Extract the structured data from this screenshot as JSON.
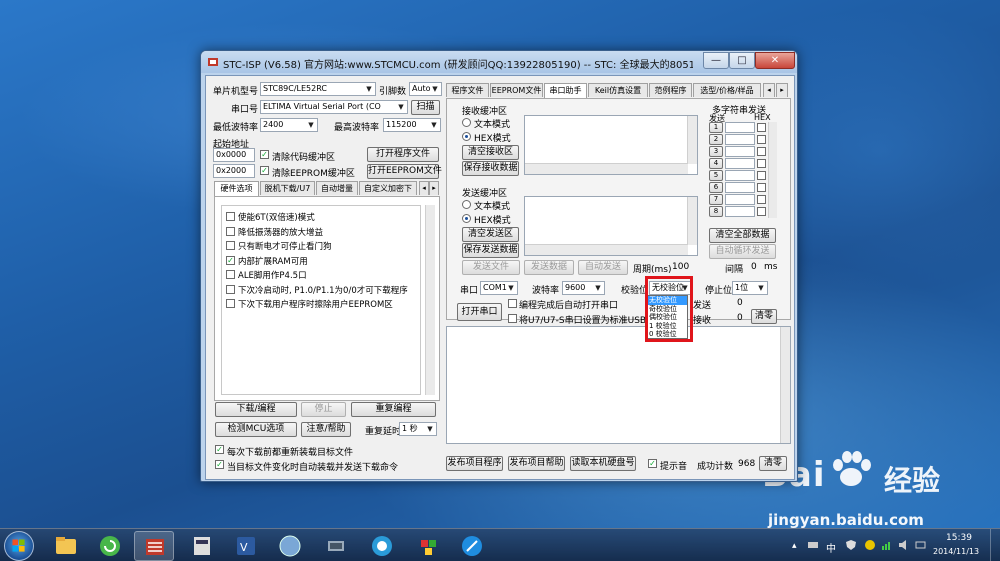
{
  "title": "STC-ISP (V6.58) 官方网站:www.STCMCU.com  (研发顾问QQ:13922805190)  -- STC: 全球最大的8051单片机设计公司 (就...",
  "window_buttons": {
    "minimize": "—",
    "maximize": "□",
    "close": "✕"
  },
  "left": {
    "mcu_label": "单片机型号",
    "mcu_value": "STC89C/LE52RC",
    "pins_label": "引脚数",
    "pins_value": "Auto",
    "port_label": "串口号",
    "port_value": "ELTIMA Virtual Serial Port (CO",
    "scan_button": "扫描",
    "min_baud_label": "最低波特率",
    "min_baud_value": "2400",
    "max_baud_label": "最高波特率",
    "max_baud_value": "115200",
    "start_addr_label": "起始地址",
    "addr1": "0x0000",
    "clear_code_label": "清除代码缓冲区",
    "open_program_button": "打开程序文件",
    "addr2": "0x2000",
    "clear_eeprom_label": "清除EEPROM缓冲区",
    "open_eeprom_button": "打开EEPROM文件",
    "tabs": [
      "硬件选项",
      "脱机下载/U7",
      "自动增量",
      "自定义加密下"
    ],
    "options": [
      {
        "label": "使能6T(双倍速)模式",
        "checked": false
      },
      {
        "label": "降低振荡器的放大增益",
        "checked": false
      },
      {
        "label": "只有断电才可停止看门狗",
        "checked": false
      },
      {
        "label": "内部扩展RAM可用",
        "checked": true
      },
      {
        "label": "ALE脚用作P4.5口",
        "checked": false
      },
      {
        "label": "下次冷启动时, P1.0/P1.1为0/0才可下载程序",
        "checked": false
      },
      {
        "label": "下次下载用户程序时擦除用户EEPROM区",
        "checked": false
      }
    ],
    "download_button": "下载/编程",
    "stop_button": "停止",
    "reprogram_button": "重复编程",
    "detect_button": "检测MCU选项",
    "help_button": "注意/帮助",
    "repeat_delay_label": "重复延时",
    "repeat_delay_value": "1 秒",
    "reload_before_label": "每次下载前都重新装载目标文件",
    "auto_reload_label": "当目标文件变化时自动装载并发送下载命令"
  },
  "right": {
    "tabs": [
      "程序文件",
      "EEPROM文件",
      "串口助手",
      "Keil仿真设置",
      "范例程序",
      "选型/价格/样品"
    ],
    "active_tab": "串口助手",
    "recv_group": "接收缓冲区",
    "text_mode": "文本模式",
    "hex_mode": "HEX模式",
    "clear_recv": "清空接收区",
    "save_recv": "保存接收数据",
    "send_group": "发送缓冲区",
    "clear_send": "清空发送区",
    "save_send": "保存发送数据",
    "send_file": "发送文件",
    "send_data": "发送数据",
    "auto_send": "自动发送",
    "period_label": "周期(ms)",
    "period_value": "100",
    "multi_title": "多字符串发送",
    "multi_send_col": "发送",
    "multi_hex_col": "HEX",
    "multi_rows": [
      "1",
      "2",
      "3",
      "4",
      "5",
      "6",
      "7",
      "8"
    ],
    "clear_all": "清空全部数据",
    "auto_loop": "自动循环发送",
    "interval_label": "间隔",
    "interval_value": "0",
    "interval_unit": "ms",
    "port_label": "串口",
    "port_value": "COM1",
    "baud_label": "波特率",
    "baud_value": "9600",
    "parity_label": "校验位",
    "parity_value": "无校验位",
    "stop_label": "停止位",
    "stop_value": "1位",
    "open_port": "打开串口",
    "auto_open_label": "编程完成后自动打开串口",
    "usb_label": "将U7/U7-S串口设置为标准USB转串口",
    "send_count_label": "发送",
    "send_count_value": "0",
    "recv_count_label": "接收",
    "recv_count_value": "0",
    "clear_count": "清零",
    "parity_options": [
      "无校验位",
      "奇校验位",
      "偶校验位",
      "1 校验位",
      "0 校验位"
    ],
    "parity_selected": 0,
    "publish_program": "发布项目程序",
    "publish_help": "发布项目帮助",
    "read_disk": "读取本机硬盘号",
    "tone_label": "提示音",
    "success_label": "成功计数",
    "success_value": "968",
    "clear_success": "清零"
  },
  "watermark": {
    "logo": "Bai",
    "brand": "经验",
    "url": "jingyan.baidu.com"
  },
  "tray": {
    "ime": "中",
    "time": "15:39",
    "date": "2014/11/13"
  }
}
